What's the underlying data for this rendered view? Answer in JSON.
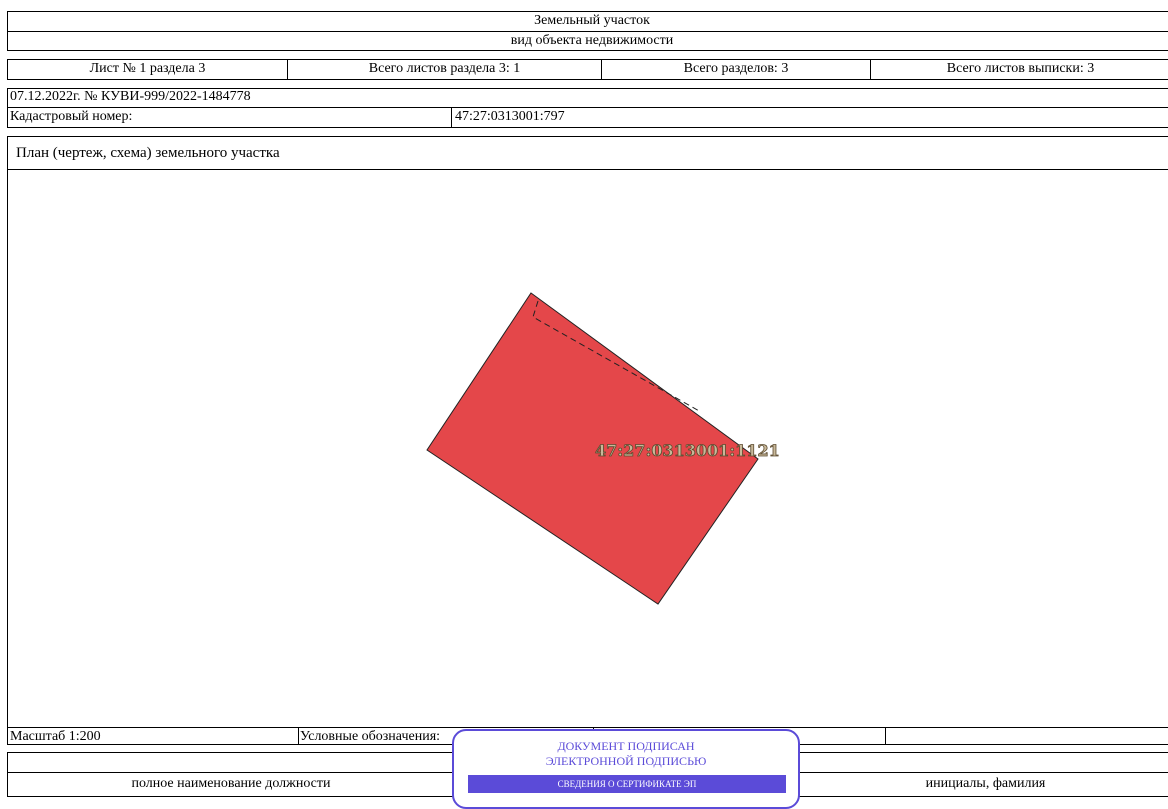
{
  "header": {
    "object_type": "Земельный участок",
    "object_subtitle": "вид объекта недвижимости"
  },
  "sheets": {
    "sheet_no": "Лист № 1 раздела 3",
    "sheets_in_section": "Всего листов раздела 3: 1",
    "total_sections": "Всего разделов: 3",
    "total_sheets": "Всего листов выписки: 3"
  },
  "record": {
    "date_number": "07.12.2022г. № КУВИ-999/2022-1484778",
    "cadastral_label": "Кадастровый номер:",
    "cadastral_value": "47:27:0313001:797"
  },
  "plan": {
    "title": "План (чертеж, схема) земельного участка",
    "parcel_label": "47:27:0313001:1121",
    "parcel_color": "#e4474a"
  },
  "footer": {
    "scale": "Масштаб 1:200",
    "legend": "Условные обозначения:",
    "position_label": "полное наименование должности",
    "initials_label": "инициалы, фамилия"
  },
  "stamp": {
    "line1": "ДОКУМЕНТ ПОДПИСАН",
    "line2": "ЭЛЕКТРОННОЙ ПОДПИСЬЮ",
    "bar": "СВЕДЕНИЯ О СЕРТИФИКАТЕ ЭП",
    "color": "#5b4bd8"
  }
}
